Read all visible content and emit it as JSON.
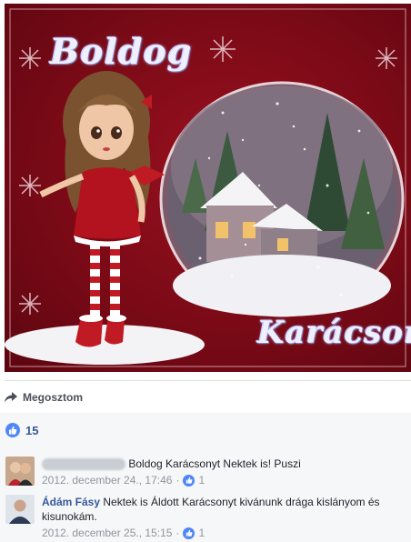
{
  "post": {
    "image": {
      "greeting_top": "Boldog",
      "greeting_bottom": "Karácsony"
    }
  },
  "actions": {
    "share_label": "Megosztom",
    "share_icon": "share-arrow-icon"
  },
  "reactions": {
    "icon": "thumbs-up-icon",
    "count": "15"
  },
  "comments": [
    {
      "author": "",
      "text": "Boldog Karácsonyt Nektek is! Puszi",
      "date": "2012. december 24., 17:46",
      "likes": "1"
    },
    {
      "author": "Ádám Fásy",
      "text": "Nektek is Áldott Karácsonyt kivánunk drága kislányom és kisunokám.",
      "date": "2012. december 25., 15:15",
      "likes": "1"
    }
  ],
  "colors": {
    "link": "#365899",
    "like_blue": "#4f86f7",
    "card_red": "#8b0d1a"
  }
}
